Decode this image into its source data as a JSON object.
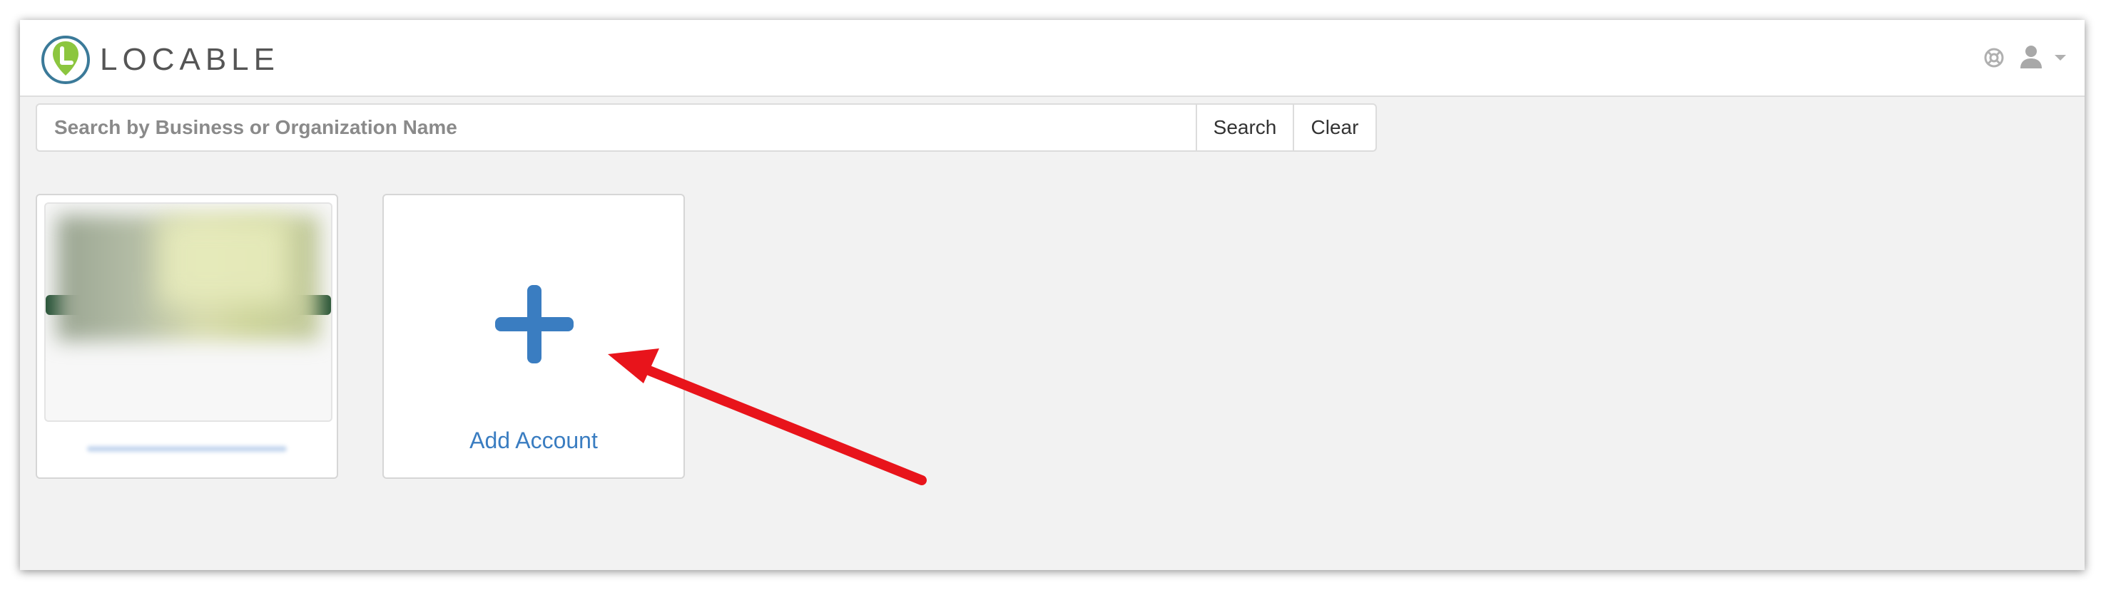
{
  "header": {
    "logo_text": "LOCABLE",
    "icons": {
      "logo": "locable-pin-logo",
      "help": "lifebuoy-help-icon",
      "user": "user-icon",
      "menu": "chevron-down-icon"
    }
  },
  "search": {
    "placeholder": "Search by Business or Organization Name",
    "value": "",
    "search_label": "Search",
    "clear_label": "Clear"
  },
  "accounts": {
    "add_label": "Add Account",
    "add_icon": "plus-icon"
  },
  "colors": {
    "accent_blue": "#3a7dc1",
    "logo_green": "#8cc63f",
    "logo_teal": "#3b7a99",
    "annotation_red": "#e8141b",
    "page_background": "#f2f2f2"
  }
}
